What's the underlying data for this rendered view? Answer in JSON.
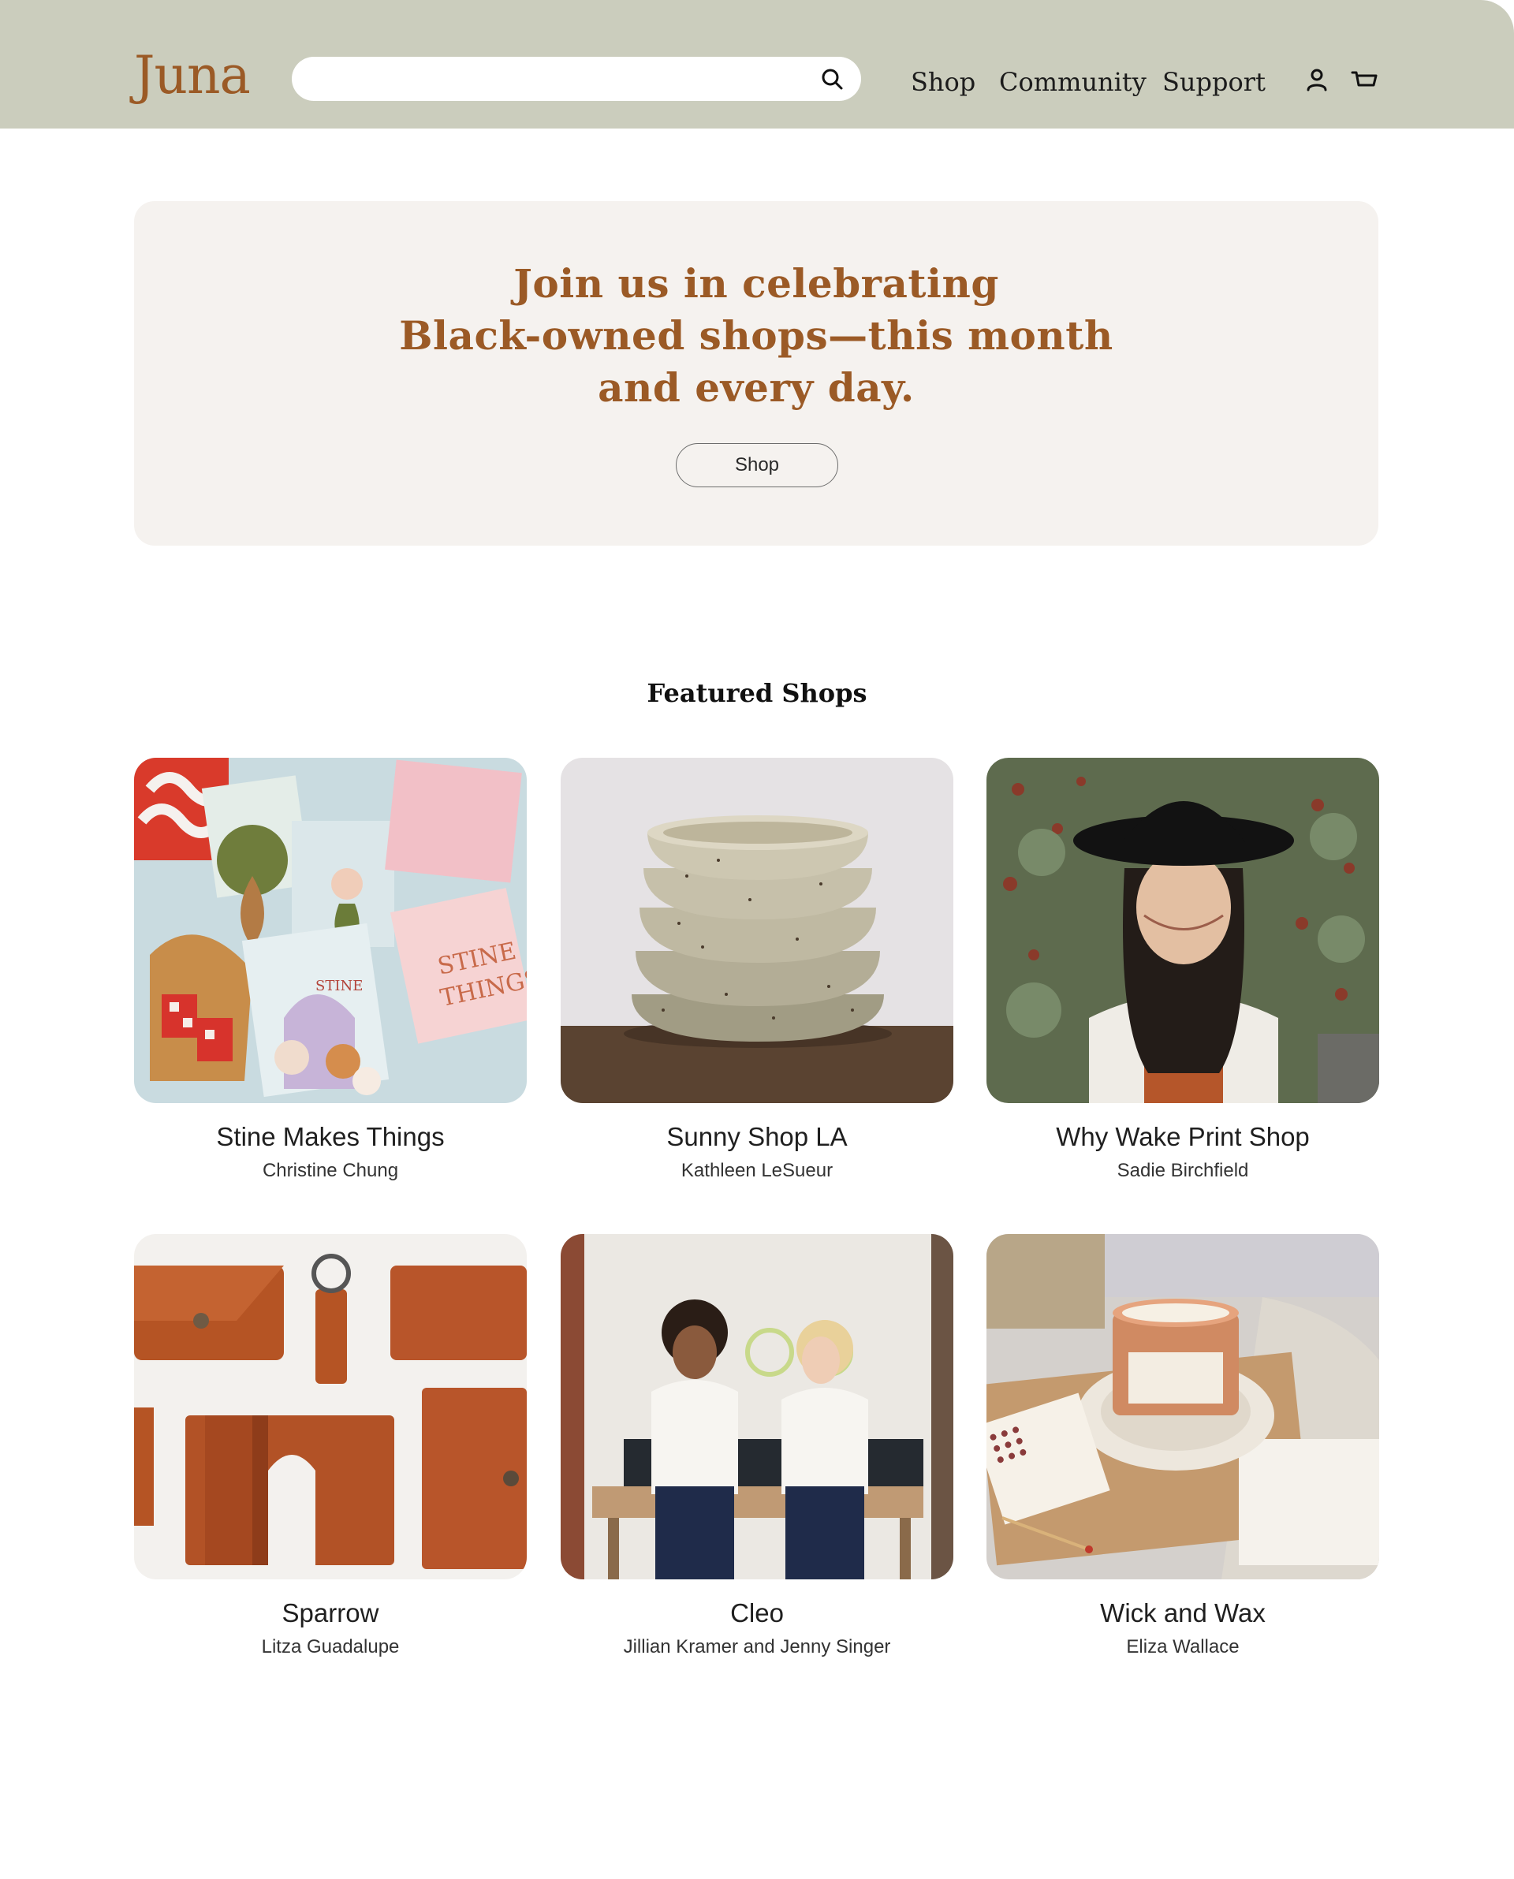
{
  "header": {
    "logo": "Juna",
    "search": {
      "value": "",
      "placeholder": ""
    },
    "nav": [
      "Shop",
      "Community",
      "Support"
    ],
    "icons": [
      "search-icon",
      "account-icon",
      "cart-icon"
    ]
  },
  "hero": {
    "title_lines": [
      "Join us in celebrating",
      "Black-owned shops—this month",
      "and every day."
    ],
    "button_label": "Shop"
  },
  "featured": {
    "title": "Featured Shops",
    "shops": [
      {
        "name": "Stine Makes Things",
        "owner": "Christine Chung"
      },
      {
        "name": "Sunny Shop LA",
        "owner": "Kathleen LeSueur"
      },
      {
        "name": "Why Wake Print Shop",
        "owner": "Sadie Birchfield"
      },
      {
        "name": "Sparrow",
        "owner": "Litza Guadalupe"
      },
      {
        "name": "Cleo",
        "owner": "Jillian Kramer and Jenny Singer"
      },
      {
        "name": "Wick and Wax",
        "owner": "Eliza Wallace"
      }
    ]
  },
  "colors": {
    "header_bg": "#cbcdbd",
    "brand": "#9b5a26",
    "hero_bg": "#f5f2ef"
  }
}
